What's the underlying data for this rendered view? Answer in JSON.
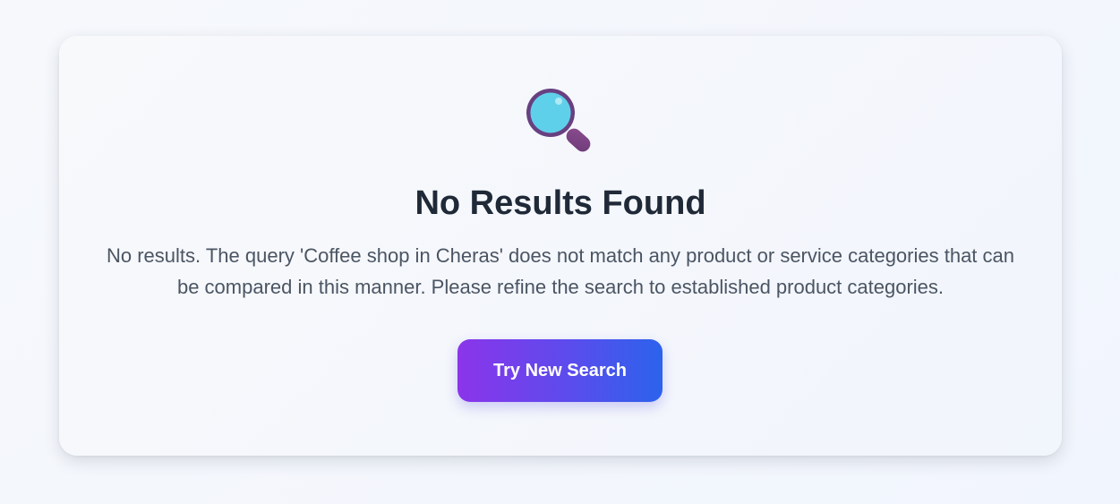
{
  "empty_state": {
    "icon": "magnifying-glass-icon",
    "title": "No Results Found",
    "message": "No results. The query 'Coffee shop in Cheras' does not match any product or service categories that can be compared in this manner. Please refine the search to established product categories.",
    "button_label": "Try New Search"
  },
  "colors": {
    "title": "#1f2937",
    "message": "#4b5563",
    "button_gradient_start": "#8b35ea",
    "button_gradient_end": "#2c63ec",
    "icon_lens": "#5fd0ea",
    "icon_frame": "#6b4387"
  }
}
